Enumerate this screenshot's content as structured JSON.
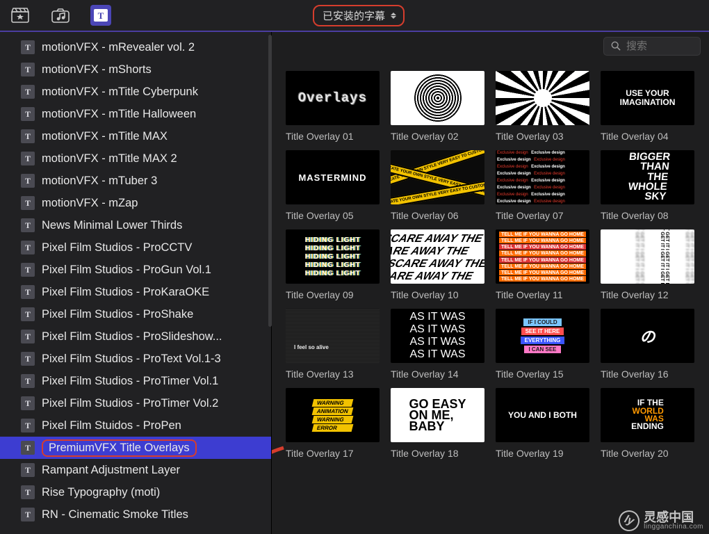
{
  "toolbar": {
    "dropdown_label": "已安装的字幕"
  },
  "search": {
    "placeholder": "搜索"
  },
  "sidebar": {
    "items": [
      {
        "label": "motionVFX - mRevealer vol. 2"
      },
      {
        "label": "motionVFX - mShorts"
      },
      {
        "label": "motionVFX - mTitle Cyberpunk"
      },
      {
        "label": "motionVFX - mTitle Halloween"
      },
      {
        "label": "motionVFX - mTitle MAX"
      },
      {
        "label": "motionVFX - mTitle MAX 2"
      },
      {
        "label": "motionVFX - mTuber 3"
      },
      {
        "label": "motionVFX - mZap"
      },
      {
        "label": "News Minimal Lower Thirds"
      },
      {
        "label": "Pixel Film Studios - ProCCTV"
      },
      {
        "label": "Pixel Film Studios - ProGun Vol.1"
      },
      {
        "label": "Pixel Film Studios - ProKaraOKE"
      },
      {
        "label": "Pixel Film Studios - ProShake"
      },
      {
        "label": "Pixel Film Studios - ProSlideshow..."
      },
      {
        "label": "Pixel Film Studios - ProText Vol.1-3"
      },
      {
        "label": "Pixel Film Studios - ProTimer Vol.1"
      },
      {
        "label": "Pixel Film Studios - ProTimer Vol.2"
      },
      {
        "label": "Pixel Film Stuidos - ProPen"
      },
      {
        "label": "PremiumVFX Title Overlays",
        "selected": true
      },
      {
        "label": "Rampant Adjustment Layer"
      },
      {
        "label": "Rise Typography (moti)"
      },
      {
        "label": "RN - Cinematic Smoke Titles"
      }
    ]
  },
  "grid": {
    "items": [
      {
        "caption": "Title Overlay 01"
      },
      {
        "caption": "Title Overlay 02"
      },
      {
        "caption": "Title Overlay 03"
      },
      {
        "caption": "Title Overlay 04"
      },
      {
        "caption": "Title Overlay 05"
      },
      {
        "caption": "Title Overlay 06"
      },
      {
        "caption": "Title Overlay 07"
      },
      {
        "caption": "Title Overlay 08"
      },
      {
        "caption": "Title Overlay 09"
      },
      {
        "caption": "Title Overlay 10"
      },
      {
        "caption": "Title Overlay 11"
      },
      {
        "caption": "Title Overlay 12"
      },
      {
        "caption": "Title Overlay 13"
      },
      {
        "caption": "Title Overlay 14"
      },
      {
        "caption": "Title Overlay 15"
      },
      {
        "caption": "Title Overlay 16"
      },
      {
        "caption": "Title Overlay 17"
      },
      {
        "caption": "Title Overlay 18"
      },
      {
        "caption": "Title Overlay 19"
      },
      {
        "caption": "Title Overlay 20"
      }
    ]
  },
  "thumbs": {
    "t1": "Overlays",
    "t4a": "USE YOUR",
    "t4b": "IMAGINATION",
    "t5": "MASTERMIND",
    "t6": "CREATE YOUR OWN STYLE VERY EASY TO CUSTOMIZE",
    "t7a": "Exclusive design",
    "t7b": "Exclusive design",
    "t8": "BIGGER\nTHAN\nTHE\nWHOLE\nSKY",
    "t9": "HIDING LIGHT",
    "t10": "SCARE AWAY THE",
    "t11": "TELL ME IF YOU WANNA GO HOME",
    "t12": "IT GET IT I GET IT I GET IT",
    "t13": "I feel so alive",
    "t14": "AS IT WAS",
    "t15a": "IF I COULD",
    "t15b": "SEE IT HERE",
    "t15c": "EVERYTHING",
    "t15d": "I CAN SEE",
    "t16": "の",
    "t17a": "WARNING",
    "t17b": "ANIMATION",
    "t17c": "ERROR",
    "t18": "GO EASY\nON ME,\nBABY",
    "t19": "YOU AND I BOTH",
    "t20a": "IF THE",
    "t20b": "WORLD",
    "t20c": "WAS",
    "t20d": "ENDING"
  },
  "watermark": {
    "cn": "灵感中国",
    "en": "lingganchina.com"
  }
}
